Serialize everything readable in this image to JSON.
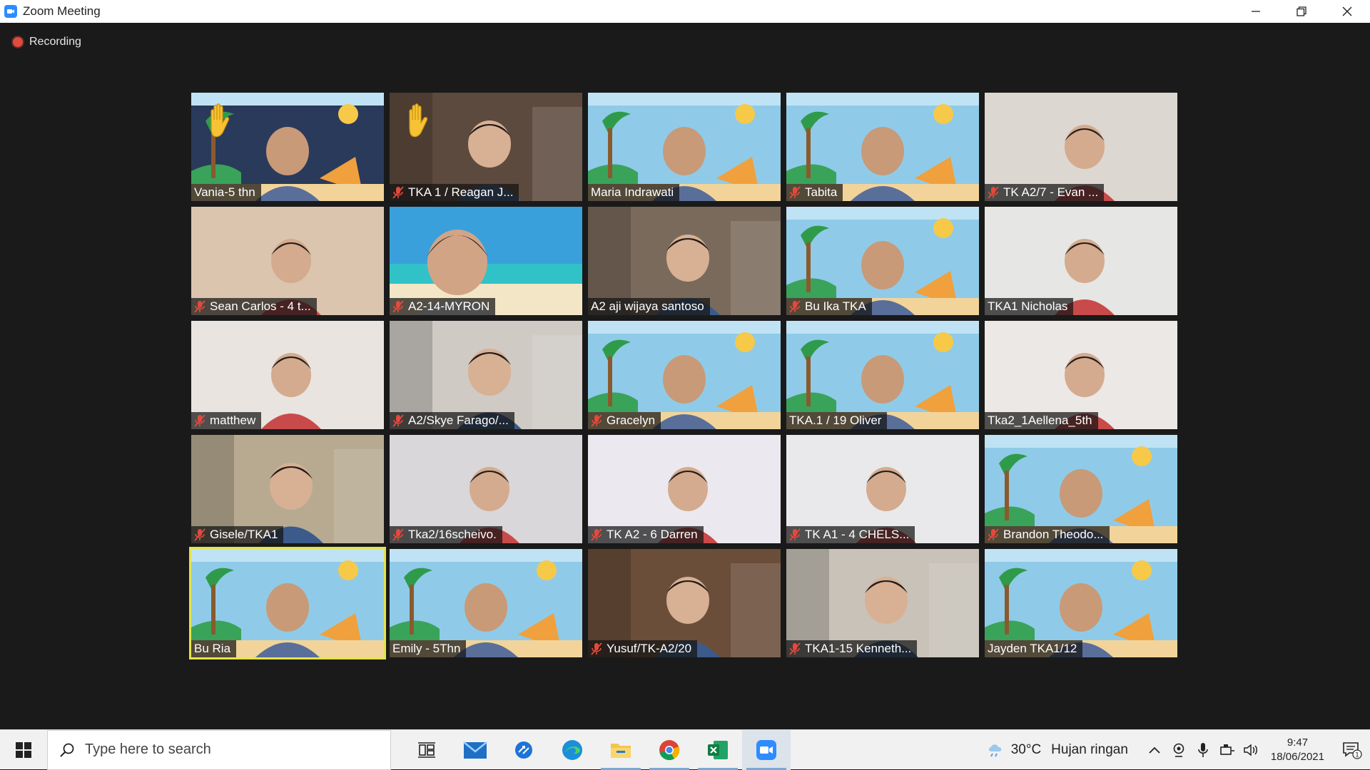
{
  "window": {
    "title": "Zoom Meeting"
  },
  "recording": {
    "label": "Recording"
  },
  "tiles": [
    {
      "name": "Vania-5 thn",
      "muted": false,
      "hand": true,
      "scene": "poster-person",
      "bg": "#2a3a5a"
    },
    {
      "name": "TKA 1 / Reagan J...",
      "muted": true,
      "hand": true,
      "scene": "room",
      "bg": "#5d4a3e"
    },
    {
      "name": "Maria Indrawati",
      "muted": false,
      "hand": false,
      "scene": "poster-person",
      "bg": "#8fcbe8"
    },
    {
      "name": "Tabita",
      "muted": true,
      "hand": false,
      "scene": "poster-person",
      "bg": "#8fcbe8"
    },
    {
      "name": "TK A2/7  -  Evan ...",
      "muted": true,
      "hand": false,
      "scene": "wall",
      "bg": "#d9d4cc"
    },
    {
      "name": "Sean Carlos - 4 t...",
      "muted": true,
      "hand": false,
      "scene": "wall",
      "bg": "#d8c0a8"
    },
    {
      "name": "A2-14-MYRON",
      "muted": true,
      "hand": false,
      "scene": "beach",
      "bg": "#3aa0dc"
    },
    {
      "name": "A2 aji wijaya santoso",
      "muted": false,
      "hand": false,
      "scene": "room",
      "bg": "#7a6a5c"
    },
    {
      "name": "Bu Ika TKA",
      "muted": true,
      "hand": false,
      "scene": "poster-person",
      "bg": "#8fcbe8"
    },
    {
      "name": "TKA1 Nicholas",
      "muted": false,
      "hand": false,
      "scene": "wall",
      "bg": "#e4e4e2"
    },
    {
      "name": "matthew",
      "muted": true,
      "hand": false,
      "scene": "wall",
      "bg": "#e8e2de"
    },
    {
      "name": "A2/Skye Farago/...",
      "muted": true,
      "hand": false,
      "scene": "room",
      "bg": "#cfcac4"
    },
    {
      "name": "Gracelyn",
      "muted": true,
      "hand": false,
      "scene": "poster-person",
      "bg": "#8fcbe8"
    },
    {
      "name": "TKA.1 / 19 Oliver",
      "muted": false,
      "hand": false,
      "scene": "poster-person",
      "bg": "#8fcbe8"
    },
    {
      "name": "Tka2_1Aellena_5th",
      "muted": false,
      "hand": false,
      "scene": "wall",
      "bg": "#ebe6e4"
    },
    {
      "name": "Gisele/TKA1",
      "muted": true,
      "hand": false,
      "scene": "room",
      "bg": "#b7aa90"
    },
    {
      "name": "Tka2/16scheivo.",
      "muted": true,
      "hand": false,
      "scene": "wall",
      "bg": "#d6d4d6"
    },
    {
      "name": "TK A2 - 6 Darren",
      "muted": true,
      "hand": false,
      "scene": "wall",
      "bg": "#ebe6ee"
    },
    {
      "name": "TK A1 - 4 CHELS...",
      "muted": true,
      "hand": false,
      "scene": "wall",
      "bg": "#e8e8ea"
    },
    {
      "name": "Brandon Theodo...",
      "muted": true,
      "hand": false,
      "scene": "poster-person",
      "bg": "#8fcbe8"
    },
    {
      "name": "Bu Ria",
      "muted": false,
      "hand": false,
      "scene": "poster-person",
      "bg": "#8fcbe8",
      "active": true
    },
    {
      "name": "Emily - 5Thn",
      "muted": false,
      "hand": false,
      "scene": "poster-person",
      "bg": "#8fcbe8"
    },
    {
      "name": "Yusuf/TK-A2/20",
      "muted": true,
      "hand": false,
      "scene": "room",
      "bg": "#6a4e3a"
    },
    {
      "name": "TKA1-15 Kenneth...",
      "muted": true,
      "hand": false,
      "scene": "room",
      "bg": "#c8c2b8"
    },
    {
      "name": "Jayden TKA1/12",
      "muted": false,
      "hand": false,
      "scene": "poster-person",
      "bg": "#8fcbe8"
    }
  ],
  "taskbar": {
    "search_placeholder": "Type here to search",
    "apps": [
      {
        "icon": "task-view-icon"
      },
      {
        "icon": "mail-icon"
      },
      {
        "icon": "onedrive-icon"
      },
      {
        "icon": "edge-icon"
      },
      {
        "icon": "file-explorer-icon"
      },
      {
        "icon": "chrome-icon"
      },
      {
        "icon": "excel-icon"
      },
      {
        "icon": "zoom-icon"
      }
    ],
    "weather_temp": "30°C",
    "weather_desc": "Hujan ringan",
    "time": "9:47",
    "date": "18/06/2021",
    "notification_count": "1"
  },
  "colors": {
    "accent": "#2d8cff",
    "active_speaker": "#e4e44a",
    "recording": "#e24a3b",
    "muted": "#e24a3b"
  }
}
